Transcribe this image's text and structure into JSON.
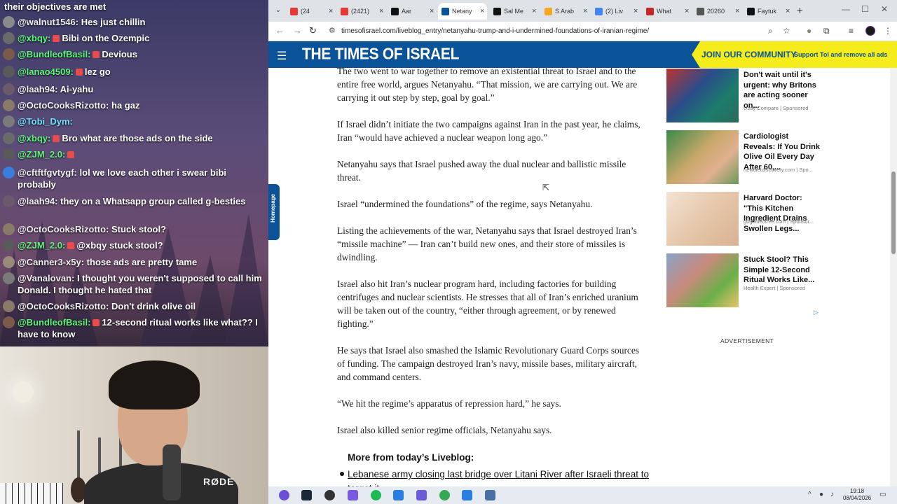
{
  "chat": {
    "header": "their objectives are met",
    "messages": [
      {
        "user": "@walnut1546:",
        "text": "Hes just chillin",
        "color": "white",
        "avatar": "#8a8a8a",
        "badge": false
      },
      {
        "user": "@xbqy:",
        "text": "Bibi on the Ozempic",
        "color": "green",
        "avatar": "#6a6a6a",
        "badge": true
      },
      {
        "user": "@BundleofBasil:",
        "text": "Devious",
        "color": "green",
        "avatar": "#7a5a4a",
        "badge": true
      },
      {
        "user": "@lanao4509:",
        "text": "lez go",
        "color": "green",
        "avatar": "#5a5a5a",
        "badge": true
      },
      {
        "user": "@laah94:",
        "text": "Ai-yahu",
        "color": "white",
        "avatar": "#6a5a6a",
        "badge": false
      },
      {
        "user": "@OctoCooksRizotto:",
        "text": "ha gaz",
        "color": "white",
        "avatar": "#8a7a6a",
        "badge": false
      },
      {
        "user": "@Tobi_Dym:",
        "text": "",
        "color": "cyan",
        "avatar": "#7a7a7a",
        "badge": false
      },
      {
        "user": "@xbqy:",
        "text": "Bro what are those ads on the side",
        "color": "green",
        "avatar": "#6a6a6a",
        "badge": true
      },
      {
        "user": "@ZJM_2.0:",
        "text": "",
        "color": "green",
        "avatar": "#5a5a5a",
        "badge": true
      },
      {
        "user": "@cftftfgvtygf:",
        "text": "lol we love each other i swear bibi probably",
        "color": "white",
        "avatar": "#3b7ddc",
        "badge": false
      },
      {
        "user": "@laah94:",
        "text": "they on a Whatsapp group called g-besties",
        "color": "white",
        "avatar": "#6a5a6a",
        "badge": false
      },
      {
        "user": "@OctoCooksRizotto:",
        "text": "Stuck stool?",
        "color": "white",
        "avatar": "#8a7a6a",
        "badge": false
      },
      {
        "user": "@ZJM_2.0:",
        "text": "@xbqy stuck stool?",
        "color": "green",
        "avatar": "#5a5a5a",
        "badge": true
      },
      {
        "user": "@Canner3-x5y:",
        "text": "those ads are pretty tame",
        "color": "white",
        "avatar": "#9a8a7a",
        "badge": false
      },
      {
        "user": "@Vanalovan:",
        "text": "I thought you weren't supposed to call him Donald. I thought he hated that",
        "color": "white",
        "avatar": "#7a7a7a",
        "badge": false
      },
      {
        "user": "@OctoCooksRizotto:",
        "text": "Don't drink olive oil",
        "color": "white",
        "avatar": "#8a7a6a",
        "badge": false
      },
      {
        "user": "@BundleofBasil:",
        "text": "12-second ritual works like what?? I have to know",
        "color": "green",
        "avatar": "#7a5a4a",
        "badge": true
      }
    ]
  },
  "webcam": {
    "brand": "RØDE"
  },
  "browser": {
    "tabs": [
      {
        "label": "(24",
        "favicon": "#e53935",
        "close": "×"
      },
      {
        "label": "(2421)",
        "favicon": "#e53935",
        "close": "×"
      },
      {
        "label": "Aar",
        "favicon": "#111111",
        "close": "×"
      },
      {
        "label": "Netany",
        "favicon": "#0b5398",
        "close": "×"
      },
      {
        "label": "Sal Me",
        "favicon": "#111111",
        "close": "×"
      },
      {
        "label": "S Arab",
        "favicon": "#f5a623",
        "close": "×"
      },
      {
        "label": "(2) Liv",
        "favicon": "#4285f4",
        "close": "×"
      },
      {
        "label": "What",
        "favicon": "#c62828",
        "close": "×"
      },
      {
        "label": "20260",
        "favicon": "#555555",
        "close": "×"
      },
      {
        "label": "Faytuk",
        "favicon": "#111111",
        "close": "×"
      }
    ],
    "new_tab": "+",
    "window_controls": {
      "minimize": "—",
      "maximize": "☐",
      "close": "✕"
    },
    "url": "timesofisrael.com/liveblog_entry/netanyahu-trump-and-i-undermined-foundations-of-iranian-regime/"
  },
  "site": {
    "logo": "THE TIMES OF ISRAEL",
    "join_title": "JOIN OUR COMMUNITY",
    "join_sub": "Support ToI and remove all ads",
    "home_tab": "Homepage"
  },
  "article": {
    "paragraphs": [
      "The two went to war together to remove an existential threat to Israel and to the entire free world, argues Netanyahu. “That mission, we are carrying out. We are carrying it out step by step, goal by goal.”",
      "If Israel didn’t initiate the two campaigns against Iran in the past year, he claims, Iran “would have achieved a nuclear weapon long ago.”",
      "Netanyahu says that Israel pushed away the dual nuclear and ballistic missile threat.",
      "Israel “undermined the foundations” of the regime, says Netanyahu.",
      "Listing the achievements of the war, Netanyahu says that Israel destroyed Iran’s “missile machine” — Iran can’t build new ones, and their store of missiles is dwindling.",
      "Israel also hit Iran’s nuclear program hard, including factories for building centrifuges and nuclear scientists. He stresses that all of Iran’s enriched uranium will be taken out of the country, “either through agreement, or by renewed fighting.”",
      "He says that Israel also smashed the Islamic Revolutionary Guard Corps sources of funding. The campaign destroyed Iran’s navy, missile bases, military aircraft, and command centers.",
      "“We hit the regime’s apparatus of repression hard,” he says.",
      "Israel also killed senior regime officials, Netanyahu says."
    ],
    "more_heading": "More from today’s Liveblog:",
    "more_link": "Lebanese army closing last bridge over Litani River after Israeli threat to target it"
  },
  "ads": [
    {
      "headline": "Don't wait until it's urgent: why Britons are acting sooner on...",
      "source": "Usay Compare | Sponsored"
    },
    {
      "headline": "Cardiologist Reveals: If You Drink Olive Oil Every Day After 60,...",
      "source": "newdietdiscovery.com | Spo..."
    },
    {
      "headline": "Harvard Doctor: \"This Kitchen Ingredient Drains Swollen Legs...",
      "source": "gogoldentree.com | Sponsor..."
    },
    {
      "headline": "Stuck Stool? This Simple 12-Second Ritual Works Like...",
      "source": "Health Expert | Sponsored"
    }
  ],
  "ad_label": "ADVERTISEMENT",
  "taskbar": {
    "time": "19:18",
    "date": "08/04/2026"
  }
}
